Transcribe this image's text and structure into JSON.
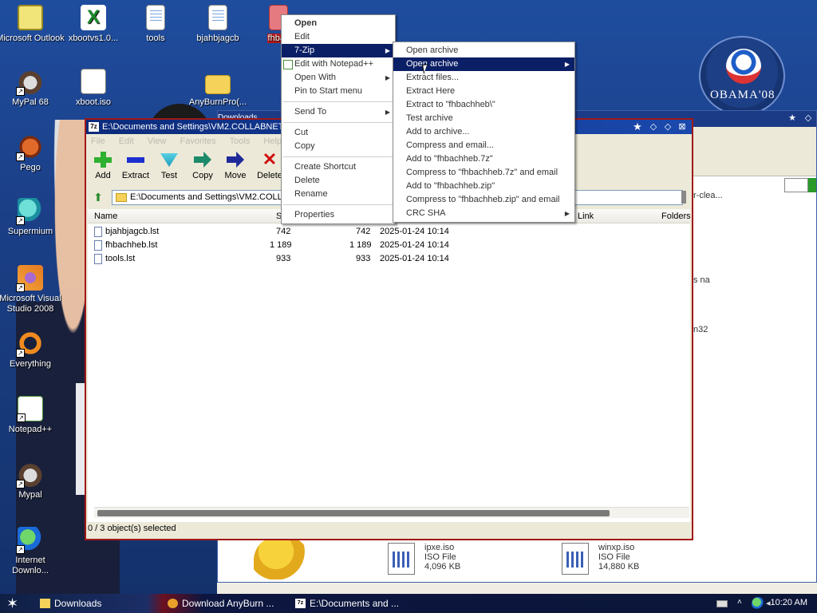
{
  "desktop": {
    "icons": [
      {
        "label": "Microsoft Outlook"
      },
      {
        "label": "xbootvs1.0..."
      },
      {
        "label": "tools"
      },
      {
        "label": "bjahbjagcb"
      },
      {
        "label": "fhbac"
      },
      {
        "label": "MyPal 68"
      },
      {
        "label": "xboot.iso"
      },
      {
        "label": "AnyBurnPro(..."
      },
      {
        "label": "Pego"
      },
      {
        "label": "Supermium"
      },
      {
        "label": "Microsoft Visual Studio 2008"
      },
      {
        "label": "Everything"
      },
      {
        "label": "Notepad++"
      },
      {
        "label": "Mypal"
      },
      {
        "label": "Internet Downlo..."
      }
    ],
    "wallpaper_logo": "OBAMA'08"
  },
  "bg_window": {
    "title_fragment": "Downloads",
    "text_fragments": [
      "r-clea...",
      "s na",
      "n32"
    ],
    "files": [
      {
        "name": "ipxe.iso",
        "type": "ISO File",
        "size": "4,096 KB"
      },
      {
        "name": "winxp.iso",
        "type": "ISO File",
        "size": "14,880 KB"
      }
    ]
  },
  "zip_window": {
    "title": "E:\\Documents and Settings\\VM2.COLLABNET\\D",
    "app_icon": "7z",
    "menu": [
      "File",
      "Edit",
      "View",
      "Favorites",
      "Tools",
      "Help"
    ],
    "tools": [
      {
        "label": "Add"
      },
      {
        "label": "Extract"
      },
      {
        "label": "Test"
      },
      {
        "label": "Copy"
      },
      {
        "label": "Move"
      },
      {
        "label": "Delete"
      }
    ],
    "address": "E:\\Documents and Settings\\VM2.COLLA",
    "columns": {
      "name": "Name",
      "size": "Si",
      "link": "Link",
      "folders": "Folders"
    },
    "rows": [
      {
        "name": "bjahbjagcb.lst",
        "size": "742",
        "packed": "742",
        "modified": "2025-01-24 10:14"
      },
      {
        "name": "fhbachheb.lst",
        "size": "1 189",
        "packed": "1 189",
        "modified": "2025-01-24 10:14"
      },
      {
        "name": "tools.lst",
        "size": "933",
        "packed": "933",
        "modified": "2025-01-24 10:14"
      }
    ],
    "status": "0 / 3 object(s) selected"
  },
  "context_menu": {
    "items": [
      {
        "label": "Open"
      },
      {
        "label": "Edit"
      },
      {
        "label": "7-Zip"
      },
      {
        "label": "Edit with Notepad++"
      },
      {
        "label": "Open With"
      },
      {
        "label": "Pin to Start menu"
      },
      {
        "label": "Send To"
      },
      {
        "label": "Cut"
      },
      {
        "label": "Copy"
      },
      {
        "label": "Create Shortcut"
      },
      {
        "label": "Delete"
      },
      {
        "label": "Rename"
      },
      {
        "label": "Properties"
      }
    ]
  },
  "zip_submenu": {
    "items": [
      {
        "label": "Open archive"
      },
      {
        "label": "Open archive"
      },
      {
        "label": "Extract files..."
      },
      {
        "label": "Extract Here"
      },
      {
        "label": "Extract to \"fhbachheb\\\""
      },
      {
        "label": "Test archive"
      },
      {
        "label": "Add to archive..."
      },
      {
        "label": "Compress and email..."
      },
      {
        "label": "Add to \"fhbachheb.7z\""
      },
      {
        "label": "Compress to \"fhbachheb.7z\" and email"
      },
      {
        "label": "Add to \"fhbachheb.zip\""
      },
      {
        "label": "Compress to \"fhbachheb.zip\" and email"
      },
      {
        "label": "CRC SHA"
      }
    ]
  },
  "taskbar": {
    "tasks": [
      {
        "label": "Downloads"
      },
      {
        "label": "Download AnyBurn ..."
      },
      {
        "label": "E:\\Documents and ..."
      }
    ],
    "clock": "10:20 AM"
  },
  "colors": {
    "selection": "#0b1f66",
    "window_border": "#a01818",
    "desktop": "#1b3f87"
  }
}
